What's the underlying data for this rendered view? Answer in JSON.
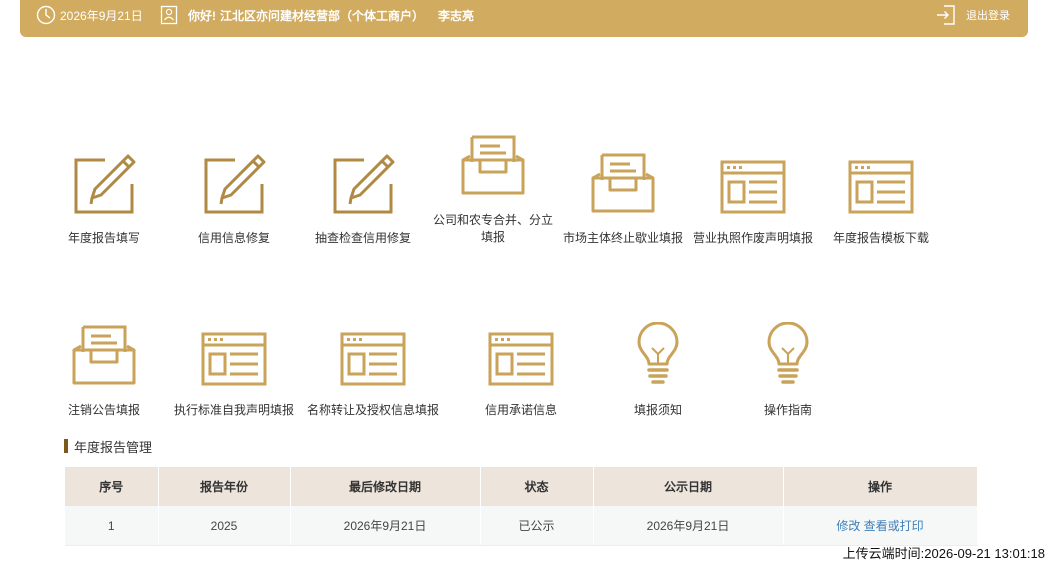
{
  "header": {
    "date": "2026年9月21日",
    "greeting": "你好!",
    "company": "江北区亦问建材经营部（个体工商户）",
    "person": "李志亮",
    "logout": "退出登录"
  },
  "tiles_row1": [
    {
      "label": "年度报告填写",
      "icon": "edit-icon"
    },
    {
      "label": "信用信息修复",
      "icon": "edit-icon"
    },
    {
      "label": "抽查检查信用修复",
      "icon": "edit-icon"
    },
    {
      "label": "公司和农专合并、分立填报",
      "icon": "inbox-icon"
    },
    {
      "label": "市场主体终止歇业填报",
      "icon": "inbox-icon"
    },
    {
      "label": "营业执照作废声明填报",
      "icon": "form-icon"
    },
    {
      "label": "年度报告模板下载",
      "icon": "form-icon"
    }
  ],
  "tiles_row2": [
    {
      "label": "注销公告填报",
      "icon": "inbox-icon"
    },
    {
      "label": "执行标准自我声明填报",
      "icon": "form-icon"
    },
    {
      "label": "名称转让及授权信息填报",
      "icon": "form-icon"
    },
    {
      "label": "信用承诺信息",
      "icon": "form-icon"
    },
    {
      "label": "填报须知",
      "icon": "lightbulb-icon"
    },
    {
      "label": "操作指南",
      "icon": "lightbulb-icon"
    }
  ],
  "section": {
    "title": "年度报告管理"
  },
  "table": {
    "headers": [
      "序号",
      "报告年份",
      "最后修改日期",
      "状态",
      "公示日期",
      "操作"
    ],
    "rows": [
      {
        "no": "1",
        "year": "2025",
        "modified": "2026年9月21日",
        "status": "已公示",
        "publish": "2026年9月21日",
        "edit": "修改",
        "view": "查看或打印"
      }
    ]
  },
  "upload_time": "上传云端时间:2026-09-21 13:01:18",
  "colors": {
    "accent": "#d1ab5f",
    "icon": "#c9a35a",
    "header_row": "#ede4dc",
    "link": "#3f7fb7"
  }
}
